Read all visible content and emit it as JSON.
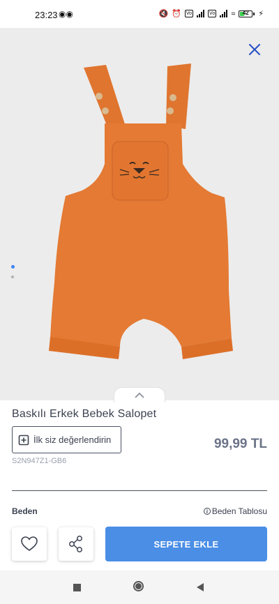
{
  "status_bar": {
    "time": "23:23",
    "battery": "42"
  },
  "product": {
    "title": "Baskılı Erkek Bebek Salopet",
    "price": "99,99 TL",
    "sku": "S2N947Z1-GB6",
    "rate_label": "İlk siz değerlendirin",
    "size_label": "Beden",
    "size_table_label": "Beden Tablosu",
    "color_swatch": "#e47a33"
  },
  "gallery": {
    "pages": 2,
    "active_page": 1
  },
  "actions": {
    "add_to_cart": "SEPETE EKLE"
  },
  "colors": {
    "accent": "#4a8ee6",
    "price": "#6b7387",
    "close_icon": "#2e56c7"
  },
  "icons": [
    "close-icon",
    "chevron-up-icon",
    "plus-square-icon",
    "info-icon",
    "heart-icon",
    "share-icon"
  ]
}
